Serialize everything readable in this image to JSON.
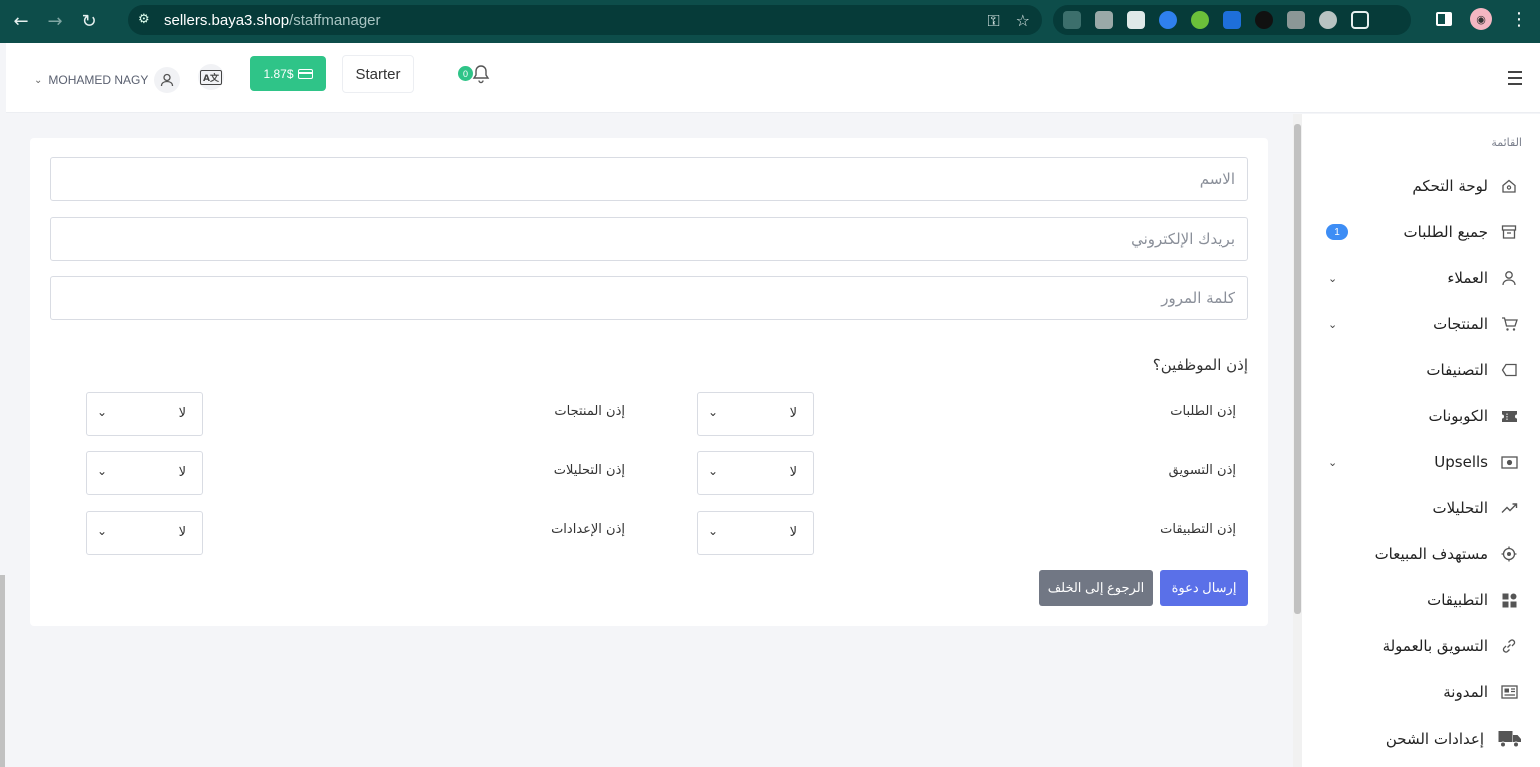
{
  "browser": {
    "url_host": "sellers.baya3.shop",
    "url_path": "/staffmanager"
  },
  "header": {
    "user_name": "MOHAMED NAGY",
    "balance": "1.87$",
    "plan": "Starter",
    "notifications_count": "0"
  },
  "sidebar": {
    "caption": "القائمة",
    "items": [
      {
        "label": "لوحة التحكم",
        "icon": "home-icon"
      },
      {
        "label": "جميع الطلبات",
        "icon": "archive-icon",
        "badge": "1"
      },
      {
        "label": "العملاء",
        "icon": "user-icon",
        "expandable": true
      },
      {
        "label": "المنتجات",
        "icon": "cart-icon",
        "expandable": true
      },
      {
        "label": "التصنيفات",
        "icon": "tag-icon"
      },
      {
        "label": "الكوبونات",
        "icon": "ticket-icon"
      },
      {
        "label": "Upsells",
        "icon": "money-icon",
        "expandable": true
      },
      {
        "label": "التحليلات",
        "icon": "trend-icon"
      },
      {
        "label": "مستهدف المبيعات",
        "icon": "target-icon"
      },
      {
        "label": "التطبيقات",
        "icon": "apps-icon"
      },
      {
        "label": "التسويق بالعمولة",
        "icon": "link-icon"
      },
      {
        "label": "المدونة",
        "icon": "news-icon"
      },
      {
        "label": "إعدادات الشحن",
        "icon": "truck-icon"
      }
    ]
  },
  "form": {
    "name_placeholder": "الاسم",
    "email_placeholder": "بريدك الإلكتروني",
    "password_placeholder": "كلمة المرور",
    "permissions_title": "إذن الموظفين؟",
    "permissions": [
      {
        "label": "إذن الطلبات",
        "value": "لا"
      },
      {
        "label": "إذن المنتجات",
        "value": "لا"
      },
      {
        "label": "إذن التسويق",
        "value": "لا"
      },
      {
        "label": "إذن التحليلات",
        "value": "لا"
      },
      {
        "label": "إذن التطبيقات",
        "value": "لا"
      },
      {
        "label": "إذن الإعدادات",
        "value": "لا"
      }
    ],
    "send_button": "إرسال دعوة",
    "back_button": "الرجوع إلى الخلف"
  },
  "colors": {
    "primary": "#5a70e8",
    "success": "#2fc488",
    "chrome": "#0d4d4a"
  }
}
